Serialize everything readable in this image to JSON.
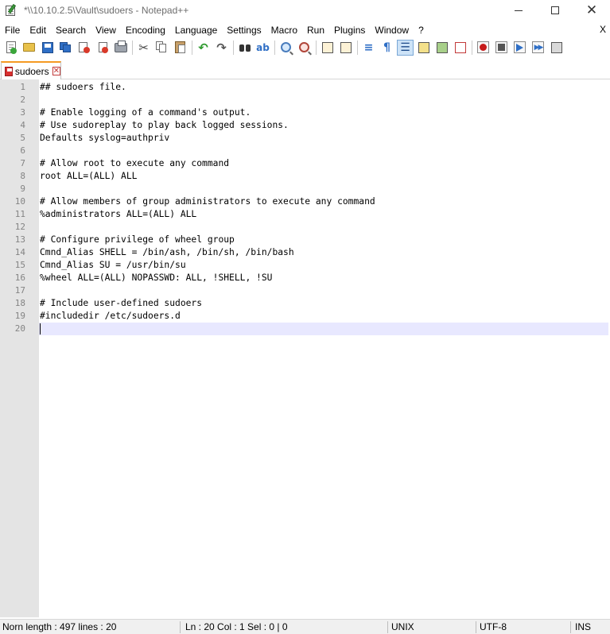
{
  "window": {
    "title": "*\\\\10.10.2.5\\Vault\\sudoers - Notepad++",
    "controls": {
      "minimize_icon": "minimize-icon",
      "maximize_icon": "maximize-icon",
      "close_glyph": "✕"
    }
  },
  "menu": {
    "items": [
      "File",
      "Edit",
      "Search",
      "View",
      "Encoding",
      "Language",
      "Settings",
      "Macro",
      "Run",
      "Plugins",
      "Window",
      "?"
    ],
    "close_label": "X"
  },
  "toolbar": {
    "icons": [
      "new-file-icon",
      "open-file-icon",
      "save-icon",
      "save-all-icon",
      "close-icon",
      "close-all-icon",
      "print-icon",
      "cut-icon",
      "copy-icon",
      "paste-icon",
      "undo-icon",
      "redo-icon",
      "find-icon",
      "replace-icon",
      "zoom-in-icon",
      "zoom-out-icon",
      "sync-vertical-icon",
      "sync-horizontal-icon",
      "word-wrap-icon",
      "show-all-chars-icon",
      "indent-guide-icon",
      "user-defined-lang-icon",
      "doc-map-icon",
      "function-list-icon",
      "record-macro-icon",
      "stop-record-icon",
      "playback-macro-icon",
      "run-macro-multiple-icon",
      "save-macro-icon"
    ],
    "active_icon": "indent-guide-icon"
  },
  "tabs": [
    {
      "label": "sudoers",
      "modified": true,
      "close_glyph": "✕"
    }
  ],
  "editor": {
    "lines": [
      "## sudoers file.",
      "",
      "# Enable logging of a command's output.",
      "# Use sudoreplay to play back logged sessions.",
      "Defaults syslog=authpriv",
      "",
      "# Allow root to execute any command",
      "root ALL=(ALL) ALL",
      "",
      "# Allow members of group administrators to execute any command",
      "%administrators ALL=(ALL) ALL",
      "",
      "# Configure privilege of wheel group",
      "Cmnd_Alias SHELL = /bin/ash, /bin/sh, /bin/bash",
      "Cmnd_Alias SU = /usr/bin/su",
      "%wheel ALL=(ALL) NOPASSWD: ALL, !SHELL, !SU",
      "",
      "# Include user-defined sudoers",
      "#includedir /etc/sudoers.d",
      ""
    ],
    "line_numbers": [
      "1",
      "2",
      "3",
      "4",
      "5",
      "6",
      "7",
      "8",
      "9",
      "10",
      "11",
      "12",
      "13",
      "14",
      "15",
      "16",
      "17",
      "18",
      "19",
      "20"
    ],
    "current_line": 20,
    "caret_line_color": "#e8e8ff"
  },
  "status": {
    "doc_info": "Norn length : 497    lines : 20",
    "position": "Ln : 20    Col : 1    Sel : 0 | 0",
    "eol": "UNIX",
    "encoding": "UTF-8",
    "mode": "INS"
  },
  "colors": {
    "tab_accent": "#f59a23",
    "gutter_bg": "#e4e4e4",
    "statusbar_bg": "#f0f0f0"
  }
}
